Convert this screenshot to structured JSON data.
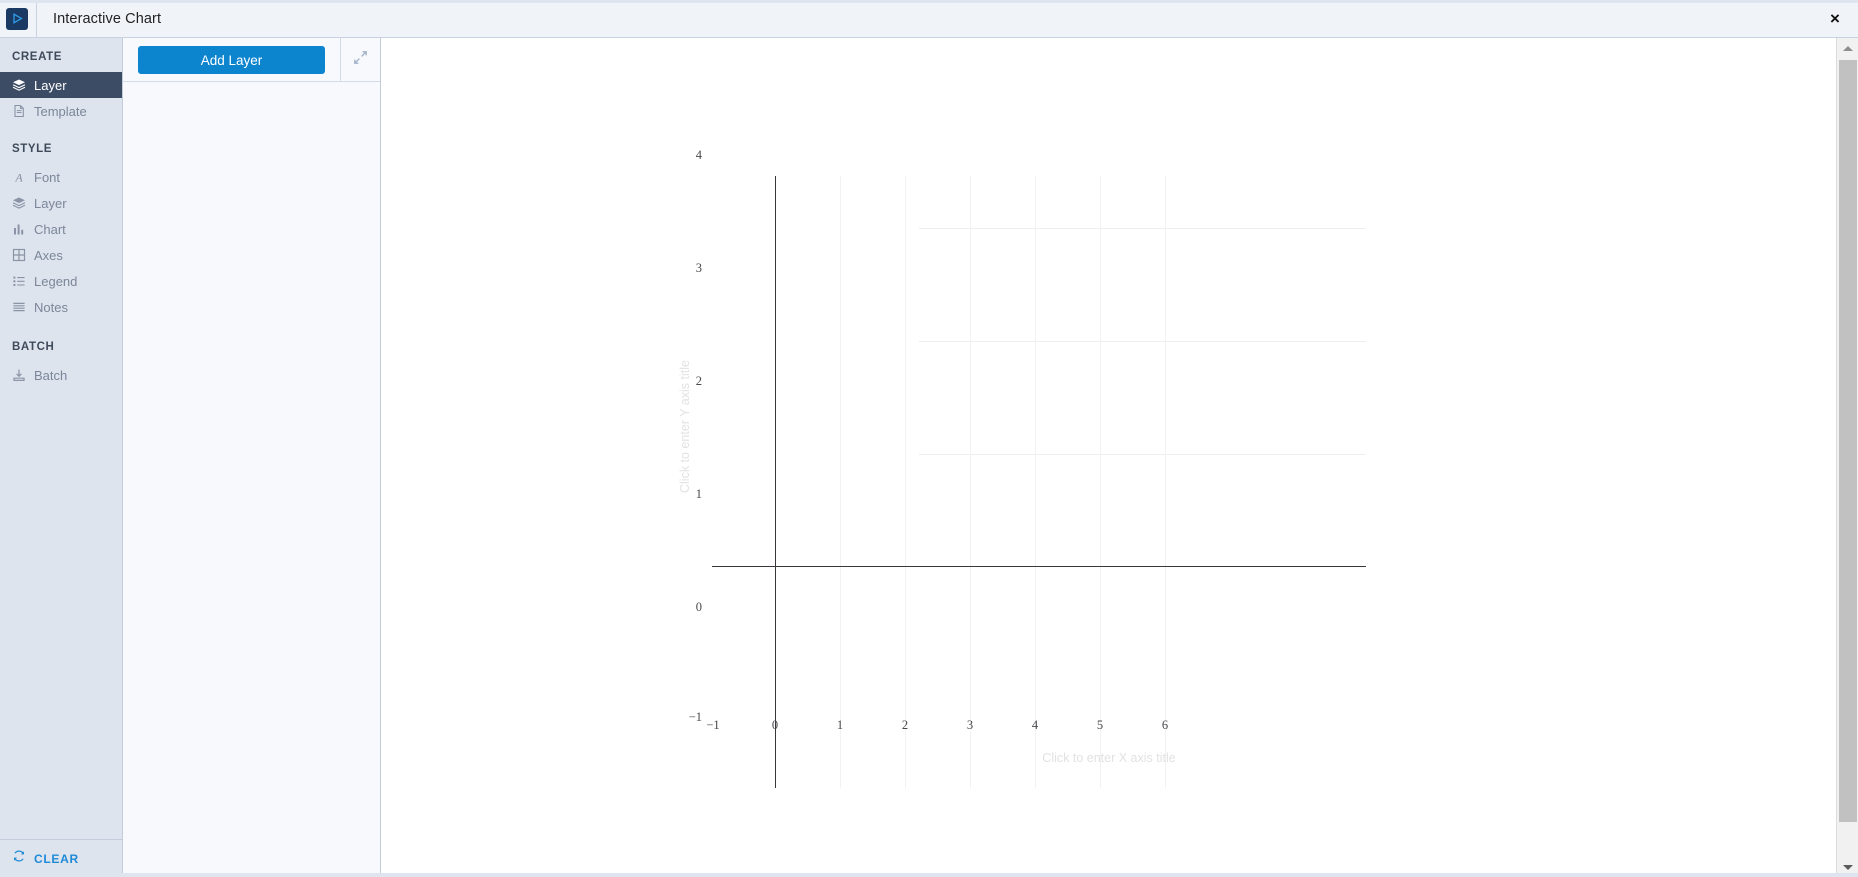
{
  "window": {
    "title": "Interactive Chart",
    "app_icon": "play-triangle-icon",
    "close_label": "×"
  },
  "sidebar": {
    "sections": [
      {
        "title": "CREATE",
        "items": [
          {
            "label": "Layer",
            "icon": "layers-icon",
            "active": true
          },
          {
            "label": "Template",
            "icon": "document-icon",
            "active": false
          }
        ]
      },
      {
        "title": "STYLE",
        "items": [
          {
            "label": "Font",
            "icon": "font-a-icon",
            "active": false
          },
          {
            "label": "Layer",
            "icon": "layers-icon",
            "active": false
          },
          {
            "label": "Chart",
            "icon": "bar-chart-icon",
            "active": false
          },
          {
            "label": "Axes",
            "icon": "grid-table-icon",
            "active": false
          },
          {
            "label": "Legend",
            "icon": "list-icon",
            "active": false
          },
          {
            "label": "Notes",
            "icon": "lines-icon",
            "active": false
          }
        ]
      },
      {
        "title": "BATCH",
        "items": [
          {
            "label": "Batch",
            "icon": "batch-import-icon",
            "active": false
          }
        ]
      }
    ],
    "clear": {
      "label": "CLEAR",
      "icon": "refresh-icon"
    }
  },
  "toolbar": {
    "add_layer_label": "Add Layer",
    "expand_icon": "expand-arrows-icon"
  },
  "scrollbar": {
    "up_icon": "scroll-up-arrow-icon",
    "down_icon": "scroll-down-arrow-icon"
  },
  "colors": {
    "accent": "#0c84ce",
    "sidebar_bg": "#dde4ee",
    "sidebar_active_bg": "#3d4c65",
    "link": "#1e8ad6",
    "axis": "#3b363c",
    "grid": "#eeeeee",
    "placeholder": "#e2e2e2"
  },
  "chart_data": {
    "type": "line",
    "title": "",
    "xlabel": "Click to enter X axis title",
    "ylabel": "Click to enter Y axis title",
    "xlim": [
      -1,
      6
    ],
    "ylim": [
      -1,
      4
    ],
    "xticks": [
      "−1",
      "0",
      "1",
      "2",
      "3",
      "4",
      "5",
      "6"
    ],
    "yticks": [
      "4",
      "3",
      "2",
      "1",
      "0",
      "−1"
    ],
    "grid": true,
    "legend": false,
    "series": [],
    "x": [],
    "values": [],
    "note": "Empty plot canvas — no data layers added yet"
  }
}
